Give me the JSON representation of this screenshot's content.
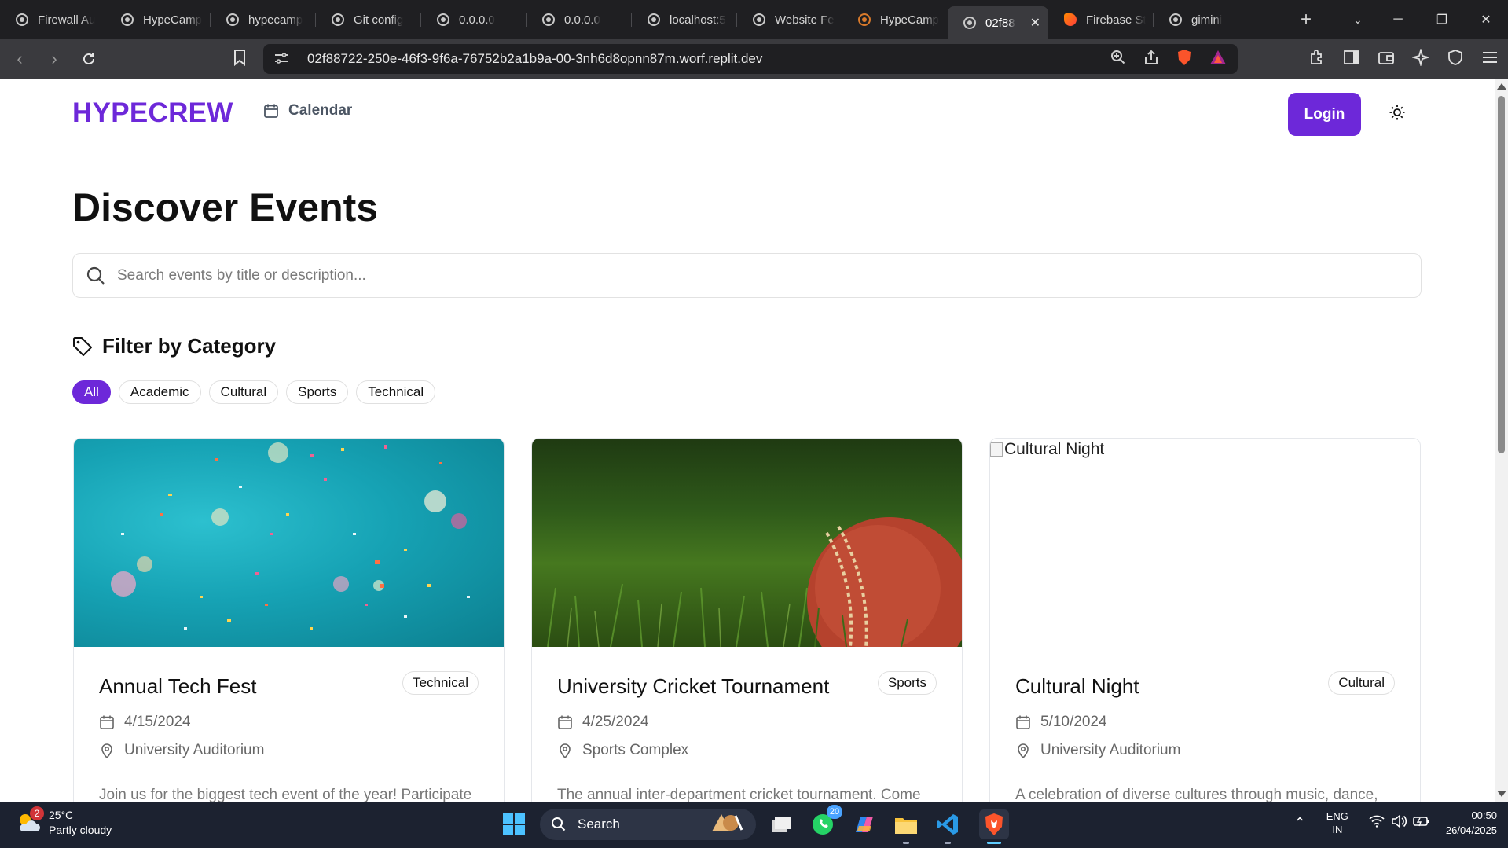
{
  "browser": {
    "tabs": [
      {
        "label": "Firewall Au",
        "icon": "globe-icon"
      },
      {
        "label": "HypeCamp",
        "icon": "github-icon"
      },
      {
        "label": "hypecamp",
        "icon": "globe-icon"
      },
      {
        "label": "Git config",
        "icon": "chatgpt-icon"
      },
      {
        "label": "0.0.0.0",
        "icon": "globe-icon"
      },
      {
        "label": "0.0.0.0",
        "icon": "globe-icon"
      },
      {
        "label": "localhost:5",
        "icon": "globe-icon"
      },
      {
        "label": "Website Fe",
        "icon": "chatgpt-icon"
      },
      {
        "label": "HypeCamp",
        "icon": "replit-icon"
      },
      {
        "label": "02f88",
        "icon": "globe-icon"
      },
      {
        "label": "Firebase St",
        "icon": "firebase-icon"
      },
      {
        "label": "gimini",
        "icon": "globe-icon"
      }
    ],
    "url": "02f88722-250e-46f3-9f6a-76752b2a1b9a-00-3nh6d8opnn87m.worf.replit.dev"
  },
  "site": {
    "logo": "HYPECREW",
    "nav_calendar": "Calendar",
    "login": "Login"
  },
  "main": {
    "heading": "Discover Events",
    "search_placeholder": "Search events by title or description...",
    "filter_title": "Filter by Category",
    "categories": [
      "All",
      "Academic",
      "Cultural",
      "Sports",
      "Technical"
    ],
    "active_category": "All"
  },
  "events": [
    {
      "title": "Annual Tech Fest",
      "category": "Technical",
      "date": "4/15/2024",
      "location": "University Auditorium",
      "description": "Join us for the biggest tech event of the year! Participate",
      "image": "confetti-photo"
    },
    {
      "title": "University Cricket Tournament",
      "category": "Sports",
      "date": "4/25/2024",
      "location": "Sports Complex",
      "description": "The annual inter-department cricket tournament. Come",
      "image": "cricket-ball-photo"
    },
    {
      "title": "Cultural Night",
      "category": "Cultural",
      "date": "5/10/2024",
      "location": "University Auditorium",
      "description": "A celebration of diverse cultures through music, dance,",
      "image_alt": "Cultural Night"
    }
  ],
  "taskbar": {
    "weather_temp": "25°C",
    "weather_desc": "Partly cloudy",
    "weather_badge": "2",
    "search_label": "Search",
    "whatsapp_badge": "20",
    "lang_top": "ENG",
    "lang_bottom": "IN",
    "time": "00:50",
    "date": "26/04/2025"
  },
  "colors": {
    "brand": "#6d28d9",
    "tabbar": "#1f1f22",
    "taskbar": "#1c2230"
  }
}
